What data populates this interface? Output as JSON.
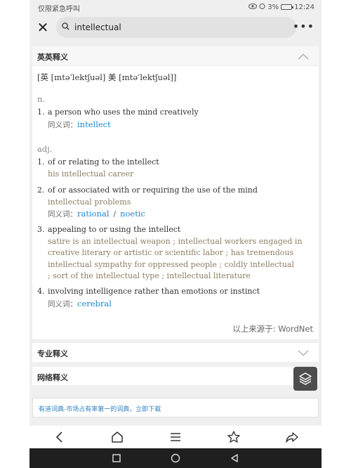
{
  "status_bar": {
    "carrier": "仅限紧急呼叫",
    "battery": "3%",
    "time": "12:24"
  },
  "search": {
    "query": "intellectual"
  },
  "sections": {
    "english": "英英释义",
    "professional": "专业释义",
    "web": "网络释义"
  },
  "entry": {
    "pronunciation": "[英 [ɪntəˈlektʃuəl] 美 [ɪntəˈlektʃuəl]]",
    "noun": {
      "pos": "n.",
      "defs": [
        {
          "num": "1.",
          "text": "a person who uses the mind creatively",
          "syn_label": "同义词：",
          "synonyms": [
            "intellect"
          ]
        }
      ]
    },
    "adj": {
      "pos": "adj.",
      "defs": [
        {
          "num": "1.",
          "text": "of or relating to the intellect",
          "example": "his intellectual career"
        },
        {
          "num": "2.",
          "text": "of or associated with or requiring the use of the mind",
          "example": "intellectual problems",
          "syn_label": "同义词：",
          "synonyms": [
            "rational",
            "noetic"
          ],
          "separator": "/"
        },
        {
          "num": "3.",
          "text": "appealing to or using the intellect",
          "example_lines": [
            "satire is an intellectual weapon  ;  intellectual workers engaged in",
            "creative literary or artistic or scientific labor  ;  has tremendous",
            "intellectual sympathy for oppressed people  ;  coldly intellectual",
            ";  sort of the intellectual type  ;  intellectual literature"
          ]
        },
        {
          "num": "4.",
          "text": "involving intelligence rather than emotions or instinct",
          "syn_label": "同义词：",
          "synonyms": [
            "cerebral"
          ]
        }
      ]
    },
    "source": "以上来源于: WordNet"
  },
  "banner": {
    "text": "有道词典-市场占有率第一的词典，立即下载"
  },
  "icons": {
    "close": "close-icon",
    "search": "search-icon",
    "more": "more-icon",
    "collapse": "chevron-up-icon",
    "expand": "chevron-down-icon",
    "layers": "layers-icon"
  },
  "colors": {
    "link": "#1e86c8",
    "example": "#8c7e62"
  }
}
